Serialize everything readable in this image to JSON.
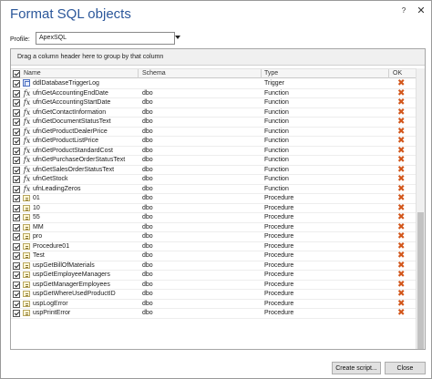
{
  "window": {
    "title": "Format SQL objects",
    "help": "?",
    "close": "✕"
  },
  "profile": {
    "label": "Profile:",
    "value": "ApexSQL"
  },
  "grid": {
    "group_hint": "Drag a column header here to group by that column",
    "columns": {
      "name": "Name",
      "schema": "Schema",
      "type": "Type",
      "ok": "OK"
    },
    "rows": [
      {
        "name": "ddlDatabaseTriggerLog",
        "schema": "",
        "type": "Trigger",
        "icon": "trigger-icon",
        "ok": "✖"
      },
      {
        "name": "ufnGetAccountingEndDate",
        "schema": "dbo",
        "type": "Function",
        "icon": "function-icon",
        "ok": "✖"
      },
      {
        "name": "ufnGetAccountingStartDate",
        "schema": "dbo",
        "type": "Function",
        "icon": "function-icon",
        "ok": "✖"
      },
      {
        "name": "ufnGetContactInformation",
        "schema": "dbo",
        "type": "Function",
        "icon": "function-icon",
        "ok": "✖"
      },
      {
        "name": "ufnGetDocumentStatusText",
        "schema": "dbo",
        "type": "Function",
        "icon": "function-icon",
        "ok": "✖"
      },
      {
        "name": "ufnGetProductDealerPrice",
        "schema": "dbo",
        "type": "Function",
        "icon": "function-icon",
        "ok": "✖"
      },
      {
        "name": "ufnGetProductListPrice",
        "schema": "dbo",
        "type": "Function",
        "icon": "function-icon",
        "ok": "✖"
      },
      {
        "name": "ufnGetProductStandardCost",
        "schema": "dbo",
        "type": "Function",
        "icon": "function-icon",
        "ok": "✖"
      },
      {
        "name": "ufnGetPurchaseOrderStatusText",
        "schema": "dbo",
        "type": "Function",
        "icon": "function-icon",
        "ok": "✖"
      },
      {
        "name": "ufnGetSalesOrderStatusText",
        "schema": "dbo",
        "type": "Function",
        "icon": "function-icon",
        "ok": "✖"
      },
      {
        "name": "ufnGetStock",
        "schema": "dbo",
        "type": "Function",
        "icon": "function-icon",
        "ok": "✖"
      },
      {
        "name": "ufnLeadingZeros",
        "schema": "dbo",
        "type": "Function",
        "icon": "function-icon",
        "ok": "✖"
      },
      {
        "name": "01",
        "schema": "dbo",
        "type": "Procedure",
        "icon": "procedure-icon",
        "ok": "✖"
      },
      {
        "name": "10",
        "schema": "dbo",
        "type": "Procedure",
        "icon": "procedure-icon",
        "ok": "✖"
      },
      {
        "name": "55",
        "schema": "dbo",
        "type": "Procedure",
        "icon": "procedure-icon",
        "ok": "✖"
      },
      {
        "name": "MM",
        "schema": "dbo",
        "type": "Procedure",
        "icon": "procedure-icon",
        "ok": "✖"
      },
      {
        "name": "pro",
        "schema": "dbo",
        "type": "Procedure",
        "icon": "procedure-icon",
        "ok": "✖"
      },
      {
        "name": "Procedure01",
        "schema": "dbo",
        "type": "Procedure",
        "icon": "procedure-icon",
        "ok": "✖"
      },
      {
        "name": "Test",
        "schema": "dbo",
        "type": "Procedure",
        "icon": "procedure-icon",
        "ok": "✖"
      },
      {
        "name": "uspGetBillOfMaterials",
        "schema": "dbo",
        "type": "Procedure",
        "icon": "procedure-icon",
        "ok": "✖"
      },
      {
        "name": "uspGetEmployeeManagers",
        "schema": "dbo",
        "type": "Procedure",
        "icon": "procedure-icon",
        "ok": "✖"
      },
      {
        "name": "uspGetManagerEmployees",
        "schema": "dbo",
        "type": "Procedure",
        "icon": "procedure-icon",
        "ok": "✖"
      },
      {
        "name": "uspGetWhereUsedProductID",
        "schema": "dbo",
        "type": "Procedure",
        "icon": "procedure-icon",
        "ok": "✖"
      },
      {
        "name": "uspLogError",
        "schema": "dbo",
        "type": "Procedure",
        "icon": "procedure-icon",
        "ok": "✖"
      },
      {
        "name": "uspPrintError",
        "schema": "dbo",
        "type": "Procedure",
        "icon": "procedure-icon",
        "ok": "✖"
      }
    ]
  },
  "buttons": {
    "create_script": "Create script...",
    "close": "Close"
  },
  "colors": {
    "title": "#2b579a",
    "ok_mark": "#d2561b"
  }
}
